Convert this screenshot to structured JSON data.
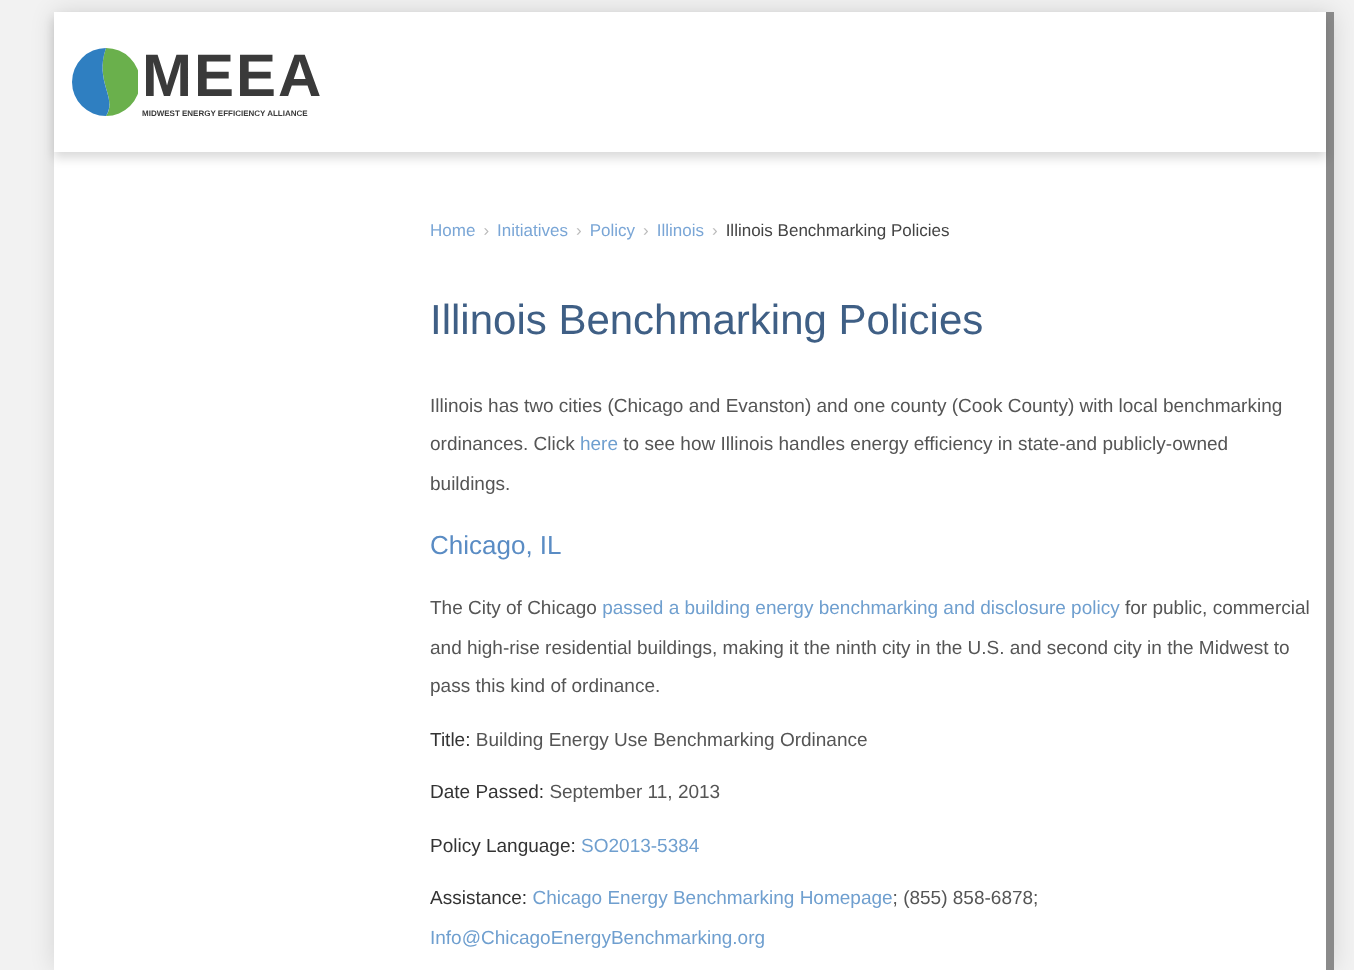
{
  "header": {
    "logo_text": "MEEA",
    "tagline": "MIDWEST ENERGY EFFICIENCY ALLIANCE"
  },
  "breadcrumb": [
    {
      "label": "Home",
      "kind": "link"
    },
    {
      "label": "Initiatives",
      "kind": "link"
    },
    {
      "label": "Policy",
      "kind": "link"
    },
    {
      "label": "Illinois",
      "kind": "link"
    },
    {
      "label": "Illinois Benchmarking Policies",
      "kind": "current"
    }
  ],
  "breadcrumb_separator": "›",
  "title": "Illinois Benchmarking Policies",
  "intro": [
    {
      "kind": "text",
      "text": "Illinois has two cities (Chicago and Evanston) and one county (Cook County) with local benchmarking ordinances. Click "
    },
    {
      "kind": "link",
      "text": "here"
    },
    {
      "kind": "text",
      "text": " to see how Illinois handles energy efficiency in state-and publicly-owned buildings."
    }
  ],
  "section": {
    "heading": "Chicago, IL",
    "paragraph": [
      {
        "kind": "text",
        "text": "The City of Chicago "
      },
      {
        "kind": "link",
        "text": "passed a building energy benchmarking and disclosure policy"
      },
      {
        "kind": "text",
        "text": " for public, commercial and high-rise residential buildings, making it the ninth city in the U.S. and second city in the Midwest to pass this kind of ordinance."
      }
    ],
    "facts": [
      {
        "label": "Title:",
        "parts": [
          {
            "kind": "text",
            "text": "Building Energy Use Benchmarking Ordinance"
          }
        ]
      },
      {
        "label": "Date Passed:",
        "parts": [
          {
            "kind": "text",
            "text": "September 11, 2013"
          }
        ]
      },
      {
        "label": "Policy Language:",
        "parts": [
          {
            "kind": "link",
            "text": "SO2013-5384"
          }
        ]
      },
      {
        "label": "Assistance:",
        "parts": [
          {
            "kind": "link",
            "text": "Chicago Energy Benchmarking Homepage"
          },
          {
            "kind": "text",
            "text": "; (855) 858-6878;"
          },
          {
            "kind": "break"
          },
          {
            "kind": "link",
            "text": "Info@ChicagoEnergyBenchmarking.org"
          }
        ]
      }
    ]
  }
}
